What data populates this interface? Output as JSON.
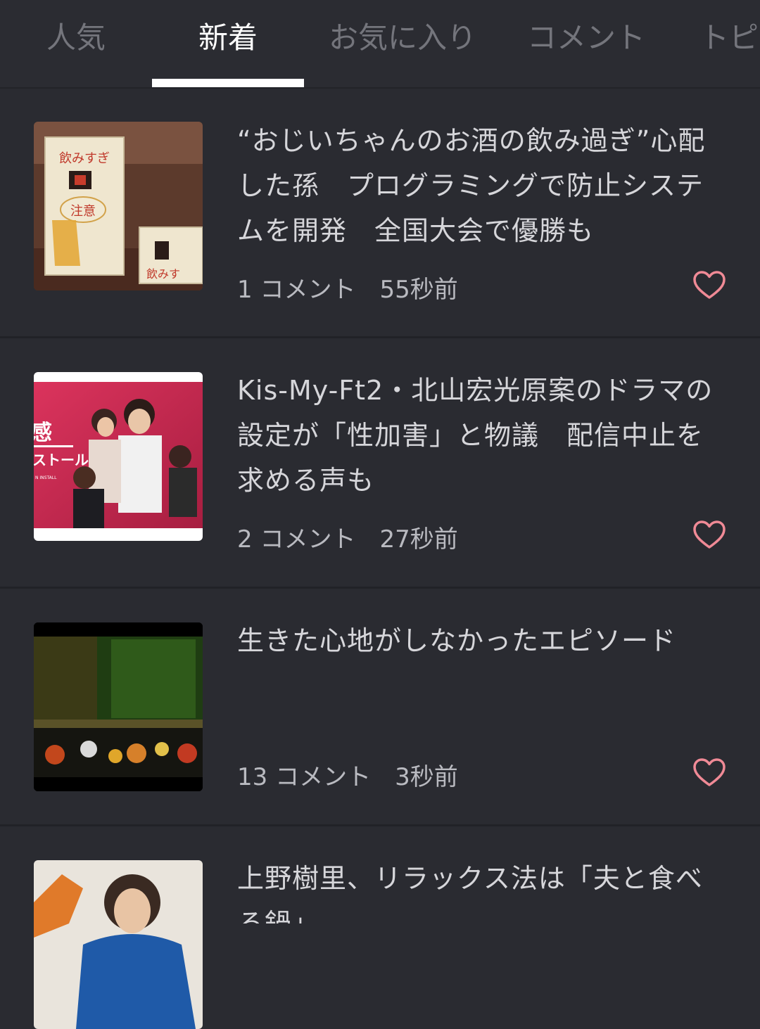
{
  "tabs": [
    {
      "label": "人気",
      "active": false
    },
    {
      "label": "新着",
      "active": true
    },
    {
      "label": "お気に入り",
      "active": false
    },
    {
      "label": "コメント",
      "active": false
    },
    {
      "label": "トピ",
      "active": false
    }
  ],
  "articles": [
    {
      "title": "“おじいちゃんのお酒の飲み過ぎ”心配した孫　プログラミングで防止システムを開発　全国大会で優勝も",
      "comments": "1 コメント",
      "time": "55秒前",
      "thumb_icon": "sake-alarm-box-photo"
    },
    {
      "title": "Kis-My-Ft2・北山宏光原案のドラマの設定が「性加害」と物議　配信中止を求める声も",
      "comments": "2 コメント",
      "time": "27秒前",
      "thumb_icon": "drama-poster-photo",
      "thumb_text": "ストール",
      "thumb_subtext": "N INSTALL"
    },
    {
      "title": "生きた心地がしなかったエピソード",
      "comments": "13 コメント",
      "time": "3秒前",
      "thumb_icon": "dark-room-toys-photo"
    },
    {
      "title": "上野樹里、リラックス法は「夫と食べる鍋」",
      "comments": "",
      "time": "",
      "thumb_icon": "woman-portrait-photo"
    }
  ],
  "colors": {
    "background": "#2a2b31",
    "heart": "#f08a96",
    "active_tab": "#ffffff",
    "inactive_tab": "#74757c"
  }
}
